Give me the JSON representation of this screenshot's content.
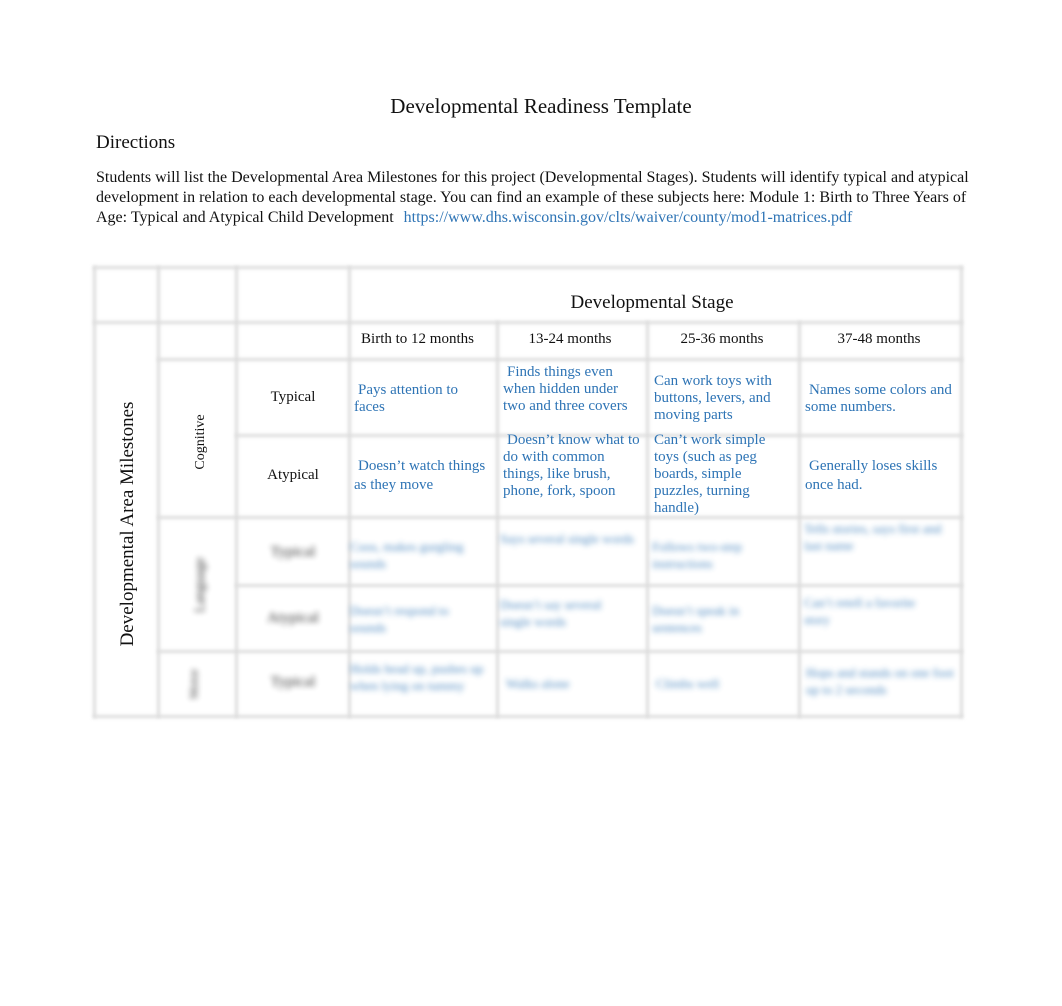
{
  "document": {
    "title": "Developmental Readiness Template",
    "directions_heading": "Directions",
    "directions_text": "Students will list the Developmental Area Milestones for this project (Developmental Stages). Students will identify typical and atypical development in relation to each developmental stage. You can find an example of these subjects here: Module 1: Birth to Three Years of Age: Typical and Atypical Child Development",
    "directions_link": "https://www.dhs.wisconsin.gov/clts/waiver/county/mod1-matrices.pdf"
  },
  "table": {
    "stage_header": "Developmental Stage",
    "side_header": "Developmental Area Milestones",
    "columns": [
      "Birth to 12 months",
      "13-24 months",
      "25-36 months",
      "37-48 months"
    ],
    "areas": [
      {
        "name": "Cognitive",
        "rows": [
          {
            "label": "Typical",
            "cells": [
              "Pays attention to faces",
              "Finds things even when hidden under two and three covers",
              "Can work toys with buttons, levers, and moving parts",
              "Names some colors and some numbers."
            ]
          },
          {
            "label": "Atypical",
            "cells": [
              "Doesn’t watch things as they move",
              "Doesn’t know what to do with common things, like brush, phone, fork, spoon",
              "Can’t work simple toys (such as peg boards, simple puzzles, turning handle)",
              "Generally loses skills once had."
            ]
          }
        ]
      },
      {
        "name": "Language",
        "blurred": true,
        "rows": [
          {
            "label": "Typical",
            "cells": [
              "Coos, makes gurgling sounds",
              "Says several single words",
              "Follows two-step instructions",
              "Tells stories, says first and last name"
            ]
          },
          {
            "label": "Atypical",
            "cells": [
              "Doesn’t respond to sounds",
              "Doesn’t say several single words",
              "Doesn’t speak in sentences",
              "Can’t retell a favorite story"
            ]
          }
        ]
      },
      {
        "name": "Motor",
        "blurred": true,
        "rows": [
          {
            "label": "Typical",
            "cells": [
              "Holds head up, pushes up when lying on tummy",
              "Walks alone",
              "Climbs well",
              "Hops and stands on one foot up to 2 seconds"
            ]
          }
        ]
      }
    ]
  }
}
